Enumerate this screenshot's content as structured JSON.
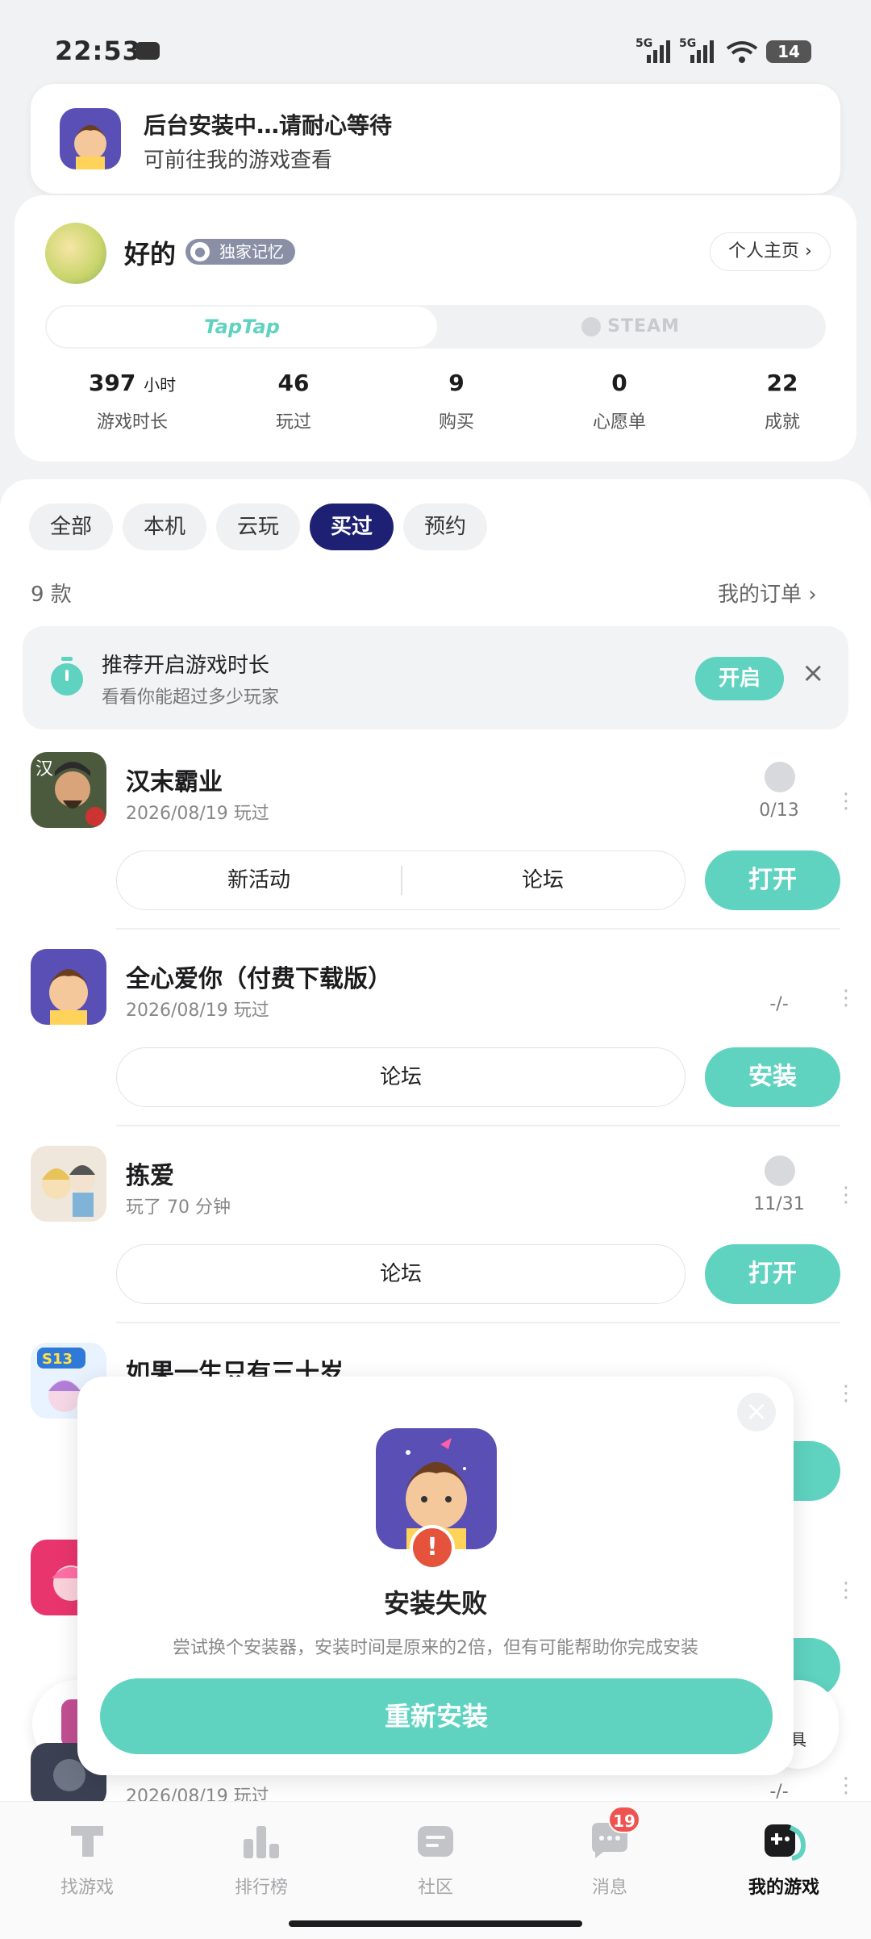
{
  "status_bar": {
    "time": "22:53",
    "network_1": "5G",
    "network_2": "5G",
    "battery": "14"
  },
  "toast": {
    "line1": "后台安装中…请耐心等待",
    "line2": "可前往我的游戏查看"
  },
  "profile": {
    "name": "好的",
    "badge": "独家记忆",
    "home_button": "个人主页 ›",
    "platform_tabs": [
      "TapTap",
      "STEAM"
    ],
    "stats": [
      {
        "value": "397",
        "unit": "小时",
        "label": "游戏时长"
      },
      {
        "value": "46",
        "unit": "",
        "label": "玩过"
      },
      {
        "value": "9",
        "unit": "",
        "label": "购买"
      },
      {
        "value": "0",
        "unit": "",
        "label": "心愿单"
      },
      {
        "value": "22",
        "unit": "",
        "label": "成就"
      }
    ]
  },
  "filters": [
    "全部",
    "本机",
    "云玩",
    "买过",
    "预约"
  ],
  "selected_filter": "买过",
  "count": "9 款",
  "orders_link": "我的订单 ›",
  "promo": {
    "title": "推荐开启游戏时长",
    "subtitle": "看看你能超过多少玩家",
    "button": "开启",
    "close": "×"
  },
  "games": [
    {
      "title": "汉末霸业",
      "sub": "2026/08/19 玩过",
      "achievement": "0/13",
      "pill": [
        "新活动",
        "论坛"
      ],
      "action": "打开"
    },
    {
      "title": "全心爱你（付费下载版）",
      "sub": "2026/08/19 玩过",
      "achievement": "-/-",
      "pill": [
        "论坛"
      ],
      "action": "安装"
    },
    {
      "title": "拣爱",
      "sub": "玩了 70 分钟",
      "achievement": "11/31",
      "pill": [
        "论坛"
      ],
      "action": "打开"
    },
    {
      "title": "如果一生只有三十岁",
      "sub": "",
      "achievement": "",
      "pill": [],
      "action": ""
    },
    {
      "title": "",
      "sub": "2026/08/19 玩过",
      "achievement": "-/-",
      "pill": [],
      "action": ""
    }
  ],
  "dialog": {
    "title": "安装失败",
    "desc": "尝试换个安装器，安装时间是原来的2倍，但有可能帮助你完成安装",
    "button": "重新安装",
    "close": "×",
    "peek_text": "具"
  },
  "nav": [
    {
      "label": "找游戏",
      "icon": "find-games-icon"
    },
    {
      "label": "排行榜",
      "icon": "leaderboard-icon"
    },
    {
      "label": "社区",
      "icon": "community-icon"
    },
    {
      "label": "消息",
      "icon": "messages-icon",
      "badge": "19"
    },
    {
      "label": "我的游戏",
      "icon": "my-games-icon"
    }
  ],
  "colors": {
    "accent": "#5fd3c0",
    "selected_chip": "#1e2073",
    "badge": "#ef5350"
  }
}
